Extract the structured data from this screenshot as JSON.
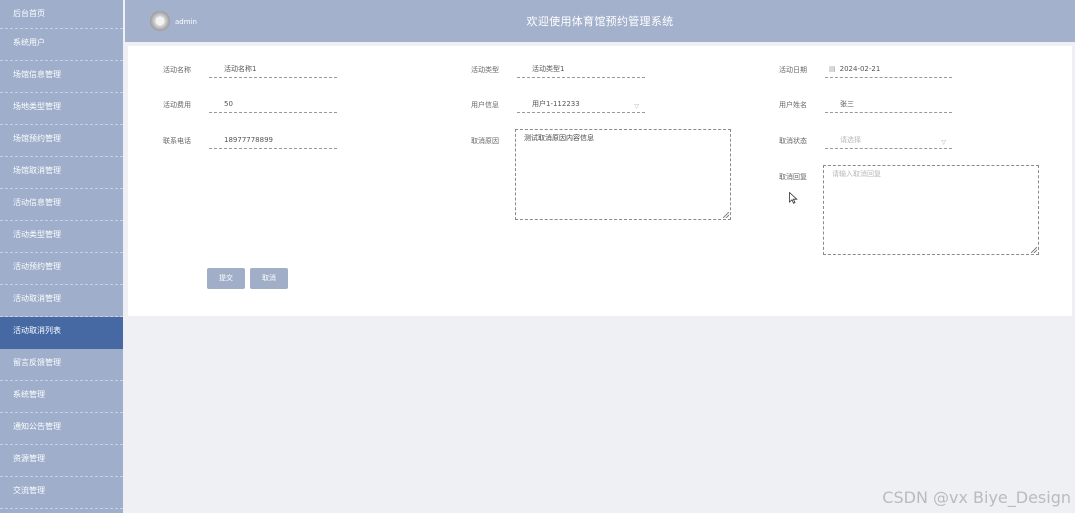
{
  "sidebar": {
    "items": [
      {
        "label": "后台首页"
      },
      {
        "label": "系统用户"
      },
      {
        "label": "场馆信息管理"
      },
      {
        "label": "场地类型管理"
      },
      {
        "label": "场馆预约管理"
      },
      {
        "label": "场馆取消管理"
      },
      {
        "label": "活动信息管理"
      },
      {
        "label": "活动类型管理"
      },
      {
        "label": "活动预约管理"
      },
      {
        "label": "活动取消管理"
      },
      {
        "label": "活动取消列表"
      },
      {
        "label": "留言反馈管理"
      },
      {
        "label": "系统管理"
      },
      {
        "label": "通知公告管理"
      },
      {
        "label": "资源管理"
      },
      {
        "label": "交流管理"
      }
    ],
    "active_index": 10
  },
  "header": {
    "user": "admin",
    "title": "欢迎使用体育馆预约管理系统"
  },
  "form": {
    "activity_name": {
      "label": "活动名称",
      "value": "活动名称1"
    },
    "activity_type": {
      "label": "活动类型",
      "value": "活动类型1"
    },
    "activity_date": {
      "label": "活动日期",
      "value": "2024-02-21",
      "icon": "calendar-icon"
    },
    "activity_fee": {
      "label": "活动费用",
      "value": "50"
    },
    "user_info": {
      "label": "用户信息",
      "value": "用户1-112233",
      "icon": "chevron-down-icon"
    },
    "user_name": {
      "label": "用户姓名",
      "value": "张三"
    },
    "phone": {
      "label": "联系电话",
      "value": "18977778899"
    },
    "cancel_reason": {
      "label": "取消原因",
      "value": "测试取消原因内容信息"
    },
    "cancel_status": {
      "label": "取消状态",
      "placeholder": "请选择",
      "icon": "chevron-down-icon"
    },
    "cancel_reply": {
      "label": "取消回复",
      "placeholder": "请输入取消回复"
    }
  },
  "buttons": {
    "submit": "提交",
    "cancel": "取消"
  },
  "watermark": "CSDN @vx Biye_Design"
}
